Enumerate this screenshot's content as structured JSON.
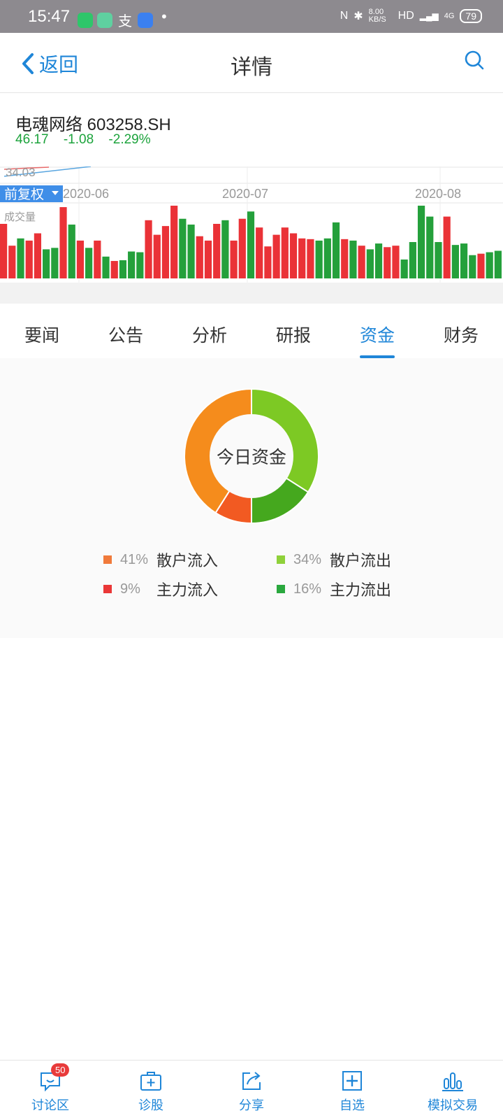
{
  "status_bar": {
    "time": "15:47",
    "network_speed": "8.00 KB/S",
    "network": "HD",
    "signal": "4G",
    "battery": "79"
  },
  "navbar": {
    "back_label": "返回",
    "title": "详情"
  },
  "stock": {
    "name": "电魂网络",
    "code": "603258.SH",
    "price": "46.17",
    "change": "-1.08",
    "change_pct": "-2.29%"
  },
  "kline": {
    "price_label": "34.03",
    "adjust_button": "前复权",
    "volume_label": "成交量",
    "dates": [
      "2020-06",
      "2020-07",
      "2020-08"
    ],
    "volume_bar_colors": [
      "red",
      "red",
      "green",
      "red",
      "red",
      "green",
      "green",
      "red",
      "green",
      "red",
      "green",
      "red",
      "green",
      "red",
      "green",
      "green",
      "green",
      "red",
      "red",
      "red",
      "red",
      "green",
      "green",
      "red",
      "red",
      "red",
      "green",
      "red",
      "red",
      "green",
      "red",
      "red",
      "red",
      "red",
      "red",
      "red",
      "red",
      "green",
      "green",
      "green",
      "red",
      "green",
      "red",
      "green",
      "green",
      "red",
      "red",
      "green",
      "green",
      "green",
      "green",
      "green",
      "red",
      "green",
      "green",
      "green",
      "red",
      "green",
      "green"
    ],
    "volume_bar_levels": [
      0.75,
      0.45,
      0.55,
      0.52,
      0.62,
      0.4,
      0.42,
      0.98,
      0.74,
      0.52,
      0.42,
      0.52,
      0.3,
      0.24,
      0.25,
      0.37,
      0.36,
      0.8,
      0.6,
      0.72,
      1.0,
      0.82,
      0.74,
      0.58,
      0.52,
      0.75,
      0.8,
      0.52,
      0.82,
      0.92,
      0.7,
      0.44,
      0.6,
      0.7,
      0.62,
      0.55,
      0.54,
      0.52,
      0.55,
      0.77,
      0.54,
      0.52,
      0.45,
      0.4,
      0.48,
      0.43,
      0.45,
      0.26,
      0.5,
      1.0,
      0.85,
      0.5,
      0.85,
      0.46,
      0.48,
      0.32,
      0.34,
      0.36,
      0.38
    ]
  },
  "tabs": [
    "要闻",
    "公告",
    "分析",
    "研报",
    "资金",
    "财务"
  ],
  "active_tab": 4,
  "fund": {
    "center_label": "今日资金",
    "items": [
      {
        "pct": "41%",
        "label": "散户流入",
        "color": "#f58c1c",
        "value": 41
      },
      {
        "pct": "34%",
        "label": "散户流出",
        "color": "#7dc924",
        "value": 34
      },
      {
        "pct": "9%",
        "label": "主力流入",
        "color": "#f25a22",
        "value": 9
      },
      {
        "pct": "16%",
        "label": "主力流出",
        "color": "#45a81e",
        "value": 16
      }
    ],
    "legend_swatch_colors": [
      "#f07a3b",
      "#8fd13a",
      "#ea3737",
      "#2aa83e"
    ]
  },
  "bottom_bar": {
    "items": [
      {
        "label": "讨论区",
        "icon": "chat-icon",
        "badge": "50"
      },
      {
        "label": "诊股",
        "icon": "medical-kit-icon"
      },
      {
        "label": "分享",
        "icon": "share-icon"
      },
      {
        "label": "自选",
        "icon": "add-box-icon"
      },
      {
        "label": "模拟交易",
        "icon": "bars-icon"
      }
    ]
  },
  "colors": {
    "accent": "#1f86d8",
    "down_green": "#1ca33c",
    "bar_red": "#ea3237",
    "bar_green": "#24a03b"
  }
}
